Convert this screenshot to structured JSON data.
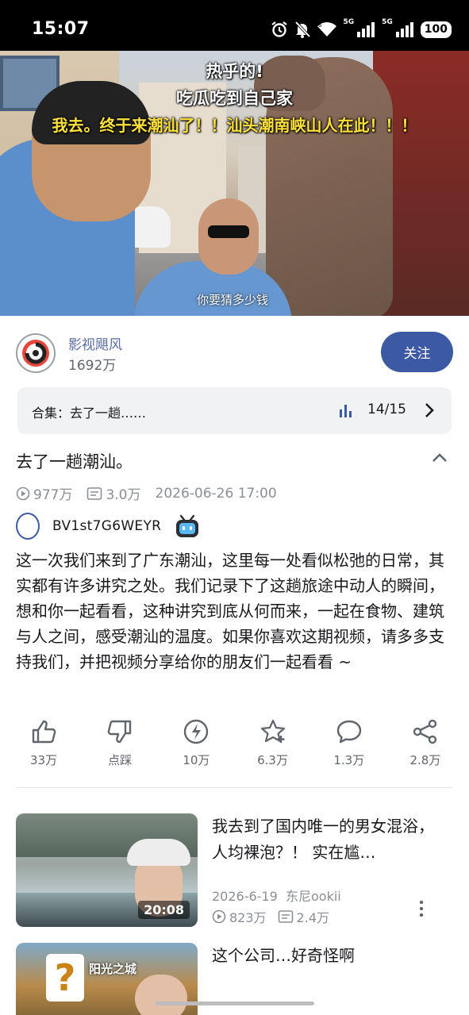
{
  "status_bar": {
    "time": "15:07",
    "icons": [
      "alarm-icon",
      "mute-icon",
      "wifi-icon",
      "signal-5g-icon",
      "signal-5g-icon-2"
    ],
    "net_label_1": "5G",
    "net_label_2": "5G",
    "battery": "100"
  },
  "video": {
    "subtitle_line1": "热乎的!",
    "subtitle_line2": "吃瓜吃到自己家",
    "subtitle_line3": "我去。终于来潮汕了！！汕头潮南峡山人在此！！！",
    "bottom_caption": "你要猜多少钱"
  },
  "uploader": {
    "name": "影视飓风",
    "fans": "1692万",
    "follow_label": "关注"
  },
  "collection": {
    "label": "合集：去了一趟……",
    "count": "14/15"
  },
  "video_info": {
    "title": "去了一趟潮汕。",
    "views": "977万",
    "danmaku": "3.0万",
    "datetime": "2026-06-26 17:00",
    "bvid": "BV1st7G6WEYR",
    "description": "这一次我们来到了广东潮汕，这里每一处看似松弛的日常，其实都有许多讲究之处。我们记录下了这趟旅途中动人的瞬间，想和你一起看看，这种讲究到底从何而来，一起在食物、建筑与人之间，感受潮汕的温度。如果你喜欢这期视频，请多多支持我们，并把视频分享给你的朋友们一起看看 ~"
  },
  "actions": {
    "like": "33万",
    "dislike": "点踩",
    "coin": "10万",
    "favorite": "6.3万",
    "comment": "1.3万",
    "share": "2.8万"
  },
  "recommendations": [
    {
      "title": "我去到了国内唯一的男女混浴，人均裸泡？！ 实在尴…",
      "duration": "20:08",
      "date": "2026-6-19",
      "author": "东尼ookii",
      "views": "823万",
      "danmaku": "2.4万"
    },
    {
      "title": "这个公司…好奇怪啊",
      "sign_text": "阳光之城"
    }
  ],
  "colors": {
    "accent": "#3c59a4",
    "subtitle_yellow": "#ffe23b",
    "text_primary": "#18191c",
    "text_secondary": "#8a8f96"
  }
}
